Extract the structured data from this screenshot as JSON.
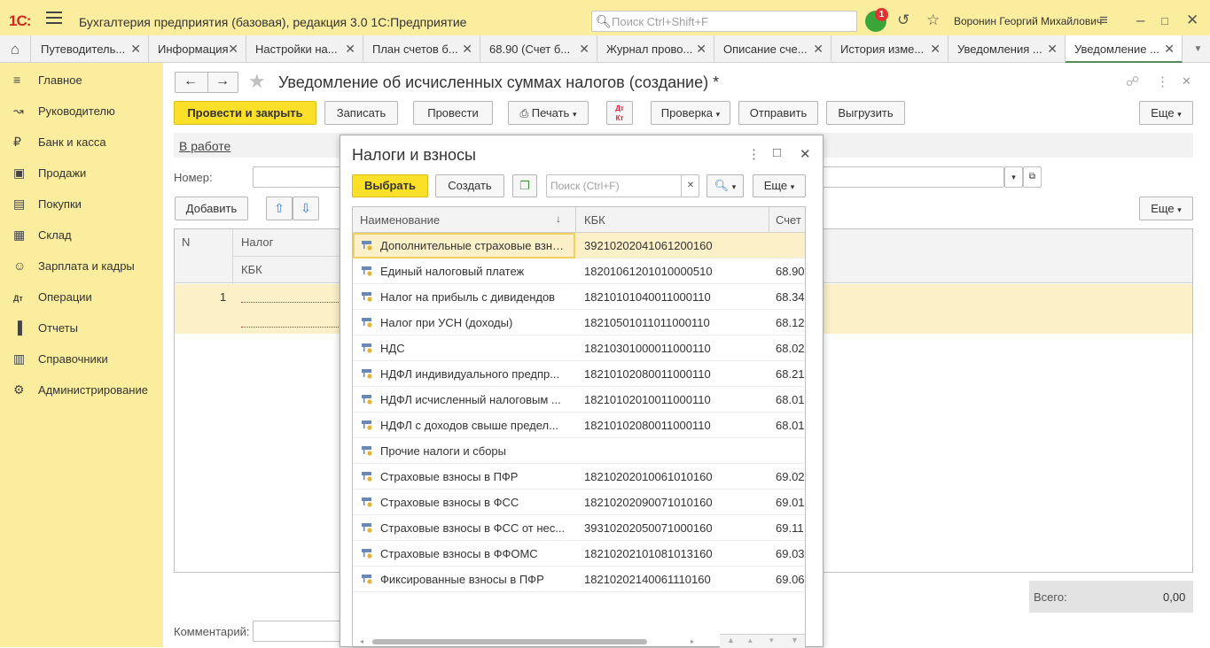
{
  "app": {
    "logo": "1С:",
    "title": "Бухгалтерия предприятия (базовая), редакция 3.0 1С:Предприятие",
    "search_placeholder": "Поиск Ctrl+Shift+F",
    "notifications_count": "1",
    "user": "Воронин Георгий Михайлович"
  },
  "tabs": [
    {
      "label": "Путеводитель..."
    },
    {
      "label": "Информация"
    },
    {
      "label": "Настройки на..."
    },
    {
      "label": "План счетов б..."
    },
    {
      "label": "68.90 (Счет б..."
    },
    {
      "label": "Журнал прово..."
    },
    {
      "label": "Описание сче..."
    },
    {
      "label": "История изме..."
    },
    {
      "label": "Уведомления ..."
    },
    {
      "label": "Уведомление ..."
    }
  ],
  "sidebar": {
    "items": [
      {
        "label": "Главное",
        "icon": "menu-icon"
      },
      {
        "label": "Руководителю",
        "icon": "trend-icon"
      },
      {
        "label": "Банк и касса",
        "icon": "ruble-icon"
      },
      {
        "label": "Продажи",
        "icon": "shopping-bag-icon"
      },
      {
        "label": "Покупки",
        "icon": "cart-icon"
      },
      {
        "label": "Склад",
        "icon": "warehouse-icon"
      },
      {
        "label": "Зарплата и кадры",
        "icon": "people-icon"
      },
      {
        "label": "Операции",
        "icon": "dt-kt-icon"
      },
      {
        "label": "Отчеты",
        "icon": "bar-chart-icon"
      },
      {
        "label": "Справочники",
        "icon": "books-icon"
      },
      {
        "label": "Администрирование",
        "icon": "gear-icon"
      }
    ]
  },
  "form": {
    "title": "Уведомление об исчисленных суммах налогов (создание) *",
    "buttons": {
      "post_close": "Провести и закрыть",
      "save": "Записать",
      "post": "Провести",
      "print": "Печать",
      "check": "Проверка",
      "send": "Отправить",
      "export": "Выгрузить",
      "more": "Еще",
      "add": "Добавить",
      "more2": "Еще"
    },
    "status_link": "В работе",
    "number_label": "Номер:",
    "comment_label": "Комментарий:",
    "table": {
      "col_n": "N",
      "col_tax": "Налог",
      "col_kbk": "КБК",
      "row_n": "1"
    },
    "total_label": "Всего:",
    "total_value": "0,00"
  },
  "modal": {
    "title": "Налоги и взносы",
    "select_button": "Выбрать",
    "create_button": "Создать",
    "search_placeholder": "Поиск (Ctrl+F)",
    "more_button": "Еще",
    "columns": {
      "name": "Наименование",
      "kbk": "КБК",
      "account": "Счет"
    },
    "rows": [
      {
        "name": "Дополнительные страховые взно...",
        "kbk": "39210202041061200160",
        "account": ""
      },
      {
        "name": "Единый налоговый платеж",
        "kbk": "18201061201010000510",
        "account": "68.90"
      },
      {
        "name": "Налог на прибыль с дивидендов",
        "kbk": "18210101040011000110",
        "account": "68.34"
      },
      {
        "name": "Налог при УСН (доходы)",
        "kbk": "18210501011011000110",
        "account": "68.12"
      },
      {
        "name": "НДС",
        "kbk": "18210301000011000110",
        "account": "68.02"
      },
      {
        "name": "НДФЛ индивидуального предпр...",
        "kbk": "18210102080011000110",
        "account": "68.21"
      },
      {
        "name": "НДФЛ исчисленный налоговым ...",
        "kbk": "18210102010011000110",
        "account": "68.01"
      },
      {
        "name": "НДФЛ с доходов свыше предел...",
        "kbk": "18210102080011000110",
        "account": "68.01"
      },
      {
        "name": "Прочие налоги и сборы",
        "kbk": "",
        "account": ""
      },
      {
        "name": "Страховые взносы в ПФР",
        "kbk": "18210202010061010160",
        "account": "69.02"
      },
      {
        "name": "Страховые взносы в ФСС",
        "kbk": "18210202090071010160",
        "account": "69.01"
      },
      {
        "name": "Страховые взносы в ФСС от нес...",
        "kbk": "39310202050071000160",
        "account": "69.11"
      },
      {
        "name": "Страховые взносы в ФФОМС",
        "kbk": "18210202101081013160",
        "account": "69.03"
      },
      {
        "name": "Фиксированные взносы в ПФР",
        "kbk": "18210202140061110160",
        "account": "69.06"
      }
    ]
  },
  "colors": {
    "accent_yellow": "#fcdf28",
    "sidebar_bg": "#fbed9e",
    "selected_row": "#fbf0c8"
  }
}
